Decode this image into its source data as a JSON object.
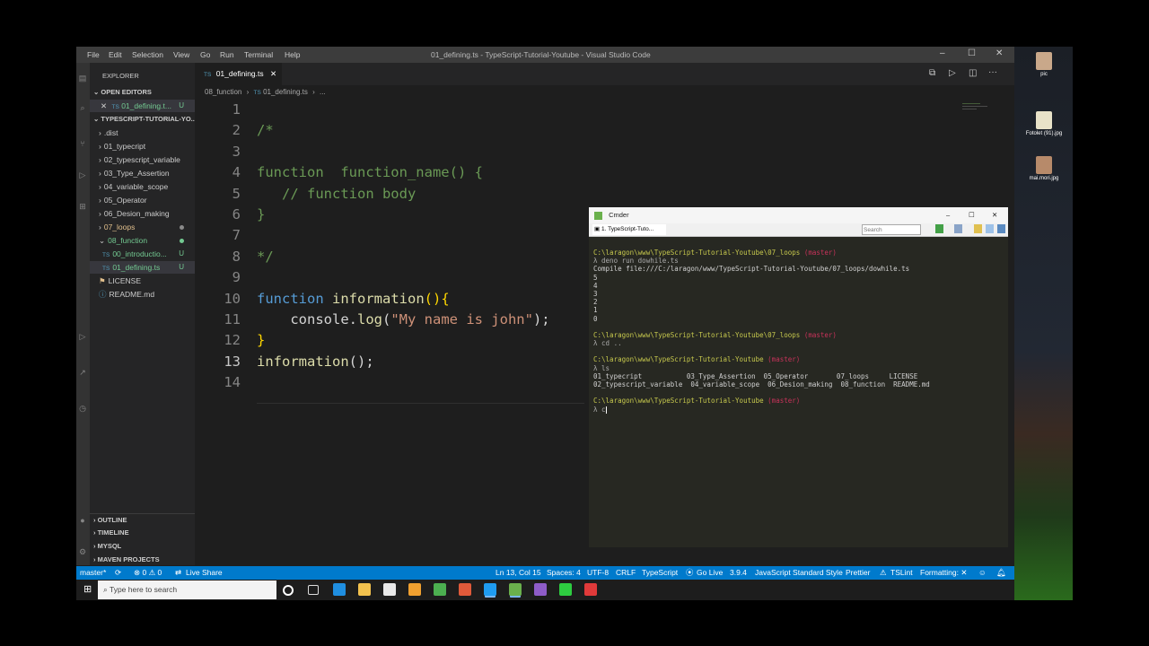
{
  "desktop": {
    "icons": [
      {
        "label": "pic",
        "color": "#c9a88a"
      },
      {
        "label": "Fotolet (91).jpg",
        "color": "#e8e2c8"
      },
      {
        "label": "mai.mori.jpg",
        "color": "#b78a6a"
      }
    ]
  },
  "window": {
    "menu": [
      "File",
      "Edit",
      "Selection",
      "View",
      "Go",
      "Run",
      "Terminal",
      "Help"
    ],
    "title": "01_defining.ts - TypeScript-Tutorial-Youtube - Visual Studio Code"
  },
  "sidebar": {
    "explorer_label": "EXPLORER",
    "open_editors_label": "OPEN EDITORS",
    "open_file": {
      "lang": "TS",
      "name": "01_defining.t...",
      "status": "U"
    },
    "project_label": "TYPESCRIPT-TUTORIAL-YO...",
    "tree": [
      {
        "name": ".dist",
        "chev": "›",
        "color": "#cccccc",
        "indent": 1
      },
      {
        "name": "01_typecript",
        "chev": "›",
        "color": "#cccccc",
        "indent": 1
      },
      {
        "name": "02_typescript_variable",
        "chev": "›",
        "color": "#cccccc",
        "indent": 1
      },
      {
        "name": "03_Type_Assertion",
        "chev": "›",
        "color": "#cccccc",
        "indent": 1
      },
      {
        "name": "04_variable_scope",
        "chev": "›",
        "color": "#cccccc",
        "indent": 1
      },
      {
        "name": "05_Operator",
        "chev": "›",
        "color": "#cccccc",
        "indent": 1
      },
      {
        "name": "06_Desion_making",
        "chev": "›",
        "color": "#cccccc",
        "indent": 1
      },
      {
        "name": "07_loops",
        "chev": "›",
        "color": "#e2c08d",
        "indent": 1
      },
      {
        "name": "08_function",
        "chev": "⌄",
        "color": "#73c991",
        "indent": 1
      },
      {
        "name": "00_introductio...",
        "lang": "TS",
        "status": "U",
        "color": "#73c991",
        "indent": 2
      },
      {
        "name": "01_defining.ts",
        "lang": "TS",
        "status": "U",
        "color": "#73c991",
        "indent": 2
      },
      {
        "name": "LICENSE",
        "color": "#cccccc",
        "indent": 1
      },
      {
        "name": "README.md",
        "color": "#cccccc",
        "indent": 1
      }
    ],
    "bottom_sections": [
      "OUTLINE",
      "TIMELINE",
      "MYSQL",
      "MAVEN PROJECTS"
    ]
  },
  "tabs": [
    {
      "lang": "TS",
      "name": "01_defining.ts"
    }
  ],
  "breadcrumb": [
    "08_function",
    "›",
    "TS",
    "01_defining.ts",
    "›",
    "..."
  ],
  "editor": {
    "lines": [
      {
        "n": "1",
        "tokens": []
      },
      {
        "n": "2",
        "tokens": [
          {
            "t": "/*",
            "c": "cm"
          }
        ]
      },
      {
        "n": "3",
        "tokens": []
      },
      {
        "n": "4",
        "tokens": [
          {
            "t": "function  function_name() {",
            "c": "cm"
          }
        ]
      },
      {
        "n": "5",
        "tokens": [
          {
            "t": "   // function body",
            "c": "cm"
          }
        ]
      },
      {
        "n": "6",
        "tokens": [
          {
            "t": "}",
            "c": "cm"
          }
        ]
      },
      {
        "n": "7",
        "tokens": []
      },
      {
        "n": "8",
        "tokens": [
          {
            "t": "*/",
            "c": "cm"
          }
        ]
      },
      {
        "n": "9",
        "tokens": []
      },
      {
        "n": "10",
        "tokens": [
          {
            "t": "function ",
            "c": "kw"
          },
          {
            "t": "information",
            "c": "fn"
          },
          {
            "t": "(){",
            "c": "pn"
          }
        ]
      },
      {
        "n": "11",
        "tokens": [
          {
            "t": "    console.",
            "c": ""
          },
          {
            "t": "log",
            "c": "fn"
          },
          {
            "t": "(",
            "c": ""
          },
          {
            "t": "\"My name is john\"",
            "c": "st"
          },
          {
            "t": ");",
            "c": ""
          }
        ]
      },
      {
        "n": "12",
        "tokens": [
          {
            "t": "}",
            "c": "pn"
          }
        ]
      },
      {
        "n": "13",
        "tokens": [
          {
            "t": "information",
            "c": "fn"
          },
          {
            "t": "();",
            "c": ""
          }
        ]
      },
      {
        "n": "14",
        "tokens": []
      }
    ]
  },
  "statusbar": {
    "branch": "master*",
    "problems": "⊗ 0 ⚠ 0",
    "live_share": "Live Share",
    "position": "Ln 13, Col 15",
    "spaces": "Spaces: 4",
    "encoding": "UTF-8",
    "eol": "CRLF",
    "language": "TypeScript",
    "go_live": "Go Live",
    "ts_version": "3.9.4",
    "style": "JavaScript Standard Style",
    "prettier": "Prettier",
    "tslint": "TSLint",
    "formatting": "Formatting: ✕"
  },
  "cmder": {
    "title": "Cmder",
    "tab_label": "1. TypeScript-Tuto...",
    "search_placeholder": "Search",
    "lines": [
      [
        {
          "t": "C:\\laragon\\www\\TypeScript-Tutorial-Youtube\\07_loops ",
          "c": "path"
        },
        {
          "t": "(master)",
          "c": "branch"
        }
      ],
      [
        {
          "t": "λ deno run dowhile.ts",
          "c": "lam"
        }
      ],
      [
        {
          "t": "Compile file:///C:/laragon/www/TypeScript-Tutorial-Youtube/07_loops/dowhile.ts",
          "c": ""
        }
      ],
      [
        {
          "t": "5",
          "c": ""
        }
      ],
      [
        {
          "t": "4",
          "c": ""
        }
      ],
      [
        {
          "t": "3",
          "c": ""
        }
      ],
      [
        {
          "t": "2",
          "c": ""
        }
      ],
      [
        {
          "t": "1",
          "c": ""
        }
      ],
      [
        {
          "t": "0",
          "c": ""
        }
      ],
      [
        {
          "t": "",
          "c": ""
        }
      ],
      [
        {
          "t": "C:\\laragon\\www\\TypeScript-Tutorial-Youtube\\07_loops ",
          "c": "path"
        },
        {
          "t": "(master)",
          "c": "branch"
        }
      ],
      [
        {
          "t": "λ cd ..",
          "c": "lam"
        }
      ],
      [
        {
          "t": "",
          "c": ""
        }
      ],
      [
        {
          "t": "C:\\laragon\\www\\TypeScript-Tutorial-Youtube ",
          "c": "path"
        },
        {
          "t": "(master)",
          "c": "branch"
        }
      ],
      [
        {
          "t": "λ ls",
          "c": "lam"
        }
      ],
      [
        {
          "t": "01_typecript           03_Type_Assertion  05_Operator       07_loops     LICENSE",
          "c": ""
        }
      ],
      [
        {
          "t": "02_typescript_variable  04_variable_scope  06_Desion_making  08_function  README.md",
          "c": ""
        }
      ],
      [
        {
          "t": "",
          "c": ""
        }
      ],
      [
        {
          "t": "C:\\laragon\\www\\TypeScript-Tutorial-Youtube ",
          "c": "path"
        },
        {
          "t": "(master)",
          "c": "branch"
        }
      ],
      [
        {
          "t": "λ c",
          "c": "lam"
        }
      ]
    ]
  },
  "taskbar": {
    "search_placeholder": "Type here to search",
    "apps": [
      {
        "name": "cortana-icon",
        "color": "#1d1d1d"
      },
      {
        "name": "task-view-icon",
        "color": "#1d1d1d"
      },
      {
        "name": "edge-icon",
        "color": "#1f8ee0"
      },
      {
        "name": "file-explorer-icon",
        "color": "#f2c14e"
      },
      {
        "name": "store-icon",
        "color": "#e8e8e8"
      },
      {
        "name": "chrome-canary-icon",
        "color": "#f0a030"
      },
      {
        "name": "notepad-icon",
        "color": "#4caf50"
      },
      {
        "name": "chrome-icon",
        "color": "#e05a3a"
      },
      {
        "name": "vscode-icon",
        "color": "#1f9cf0"
      },
      {
        "name": "cmder-icon",
        "color": "#6ab04c"
      },
      {
        "name": "obs-icon",
        "color": "#8e5cc8"
      },
      {
        "name": "terminal-icon",
        "color": "#2ecc40"
      },
      {
        "name": "laragon-icon",
        "color": "#e03a3a"
      }
    ]
  }
}
